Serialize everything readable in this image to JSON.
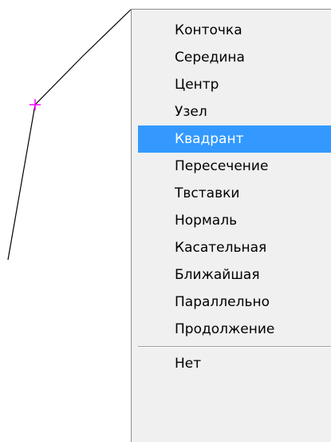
{
  "colors": {
    "selection": "#3399ff",
    "menu_bg": "#f0f0f0",
    "cursor_marker": "#ff00ff",
    "drawn_line": "#000000"
  },
  "drawing": {
    "cursor_marker_icon": "magenta-crosshair-icon"
  },
  "menu": {
    "items": [
      {
        "label": "Конточка",
        "selected": false
      },
      {
        "label": "Середина",
        "selected": false
      },
      {
        "label": "Центр",
        "selected": false
      },
      {
        "label": "Узел",
        "selected": false
      },
      {
        "label": "Квадрант",
        "selected": true
      },
      {
        "label": "Пересечение",
        "selected": false
      },
      {
        "label": "Твставки",
        "selected": false
      },
      {
        "label": "Нормаль",
        "selected": false
      },
      {
        "label": "Касательная",
        "selected": false
      },
      {
        "label": "Ближайшая",
        "selected": false
      },
      {
        "label": "Параллельно",
        "selected": false
      },
      {
        "label": "Продолжение",
        "selected": false
      }
    ],
    "none_label": "Нет"
  }
}
